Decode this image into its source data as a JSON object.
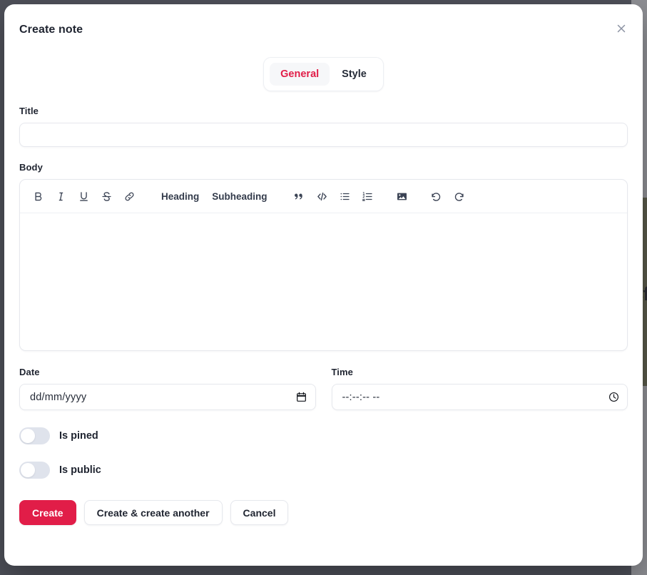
{
  "modal": {
    "title": "Create note",
    "close_label": "Close",
    "close_icon": "close-icon"
  },
  "tabs": [
    {
      "label": "General",
      "active": true
    },
    {
      "label": "Style",
      "active": false
    }
  ],
  "fields": {
    "title": {
      "label": "Title",
      "value": "",
      "placeholder": ""
    },
    "body": {
      "label": "Body",
      "value": "",
      "placeholder": ""
    },
    "date": {
      "label": "Date",
      "value": "",
      "placeholder": "dd/mm/yyyy",
      "icon": "calendar-icon"
    },
    "time": {
      "label": "Time",
      "value": "",
      "placeholder": "--:--:-- --",
      "icon": "clock-icon"
    }
  },
  "editor_toolbar": [
    {
      "name": "bold-icon",
      "label": "Bold",
      "type": "icon"
    },
    {
      "name": "italic-icon",
      "label": "Italic",
      "type": "icon"
    },
    {
      "name": "underline-icon",
      "label": "Underline",
      "type": "icon"
    },
    {
      "name": "strikethrough-icon",
      "label": "Strikethrough",
      "type": "icon"
    },
    {
      "name": "link-icon",
      "label": "Link",
      "type": "icon"
    },
    {
      "name": "heading-button",
      "label": "Heading",
      "type": "text"
    },
    {
      "name": "subheading-button",
      "label": "Subheading",
      "type": "text"
    },
    {
      "name": "blockquote-icon",
      "label": "Blockquote",
      "type": "icon"
    },
    {
      "name": "code-block-icon",
      "label": "Code block",
      "type": "icon"
    },
    {
      "name": "bullet-list-icon",
      "label": "Bullet list",
      "type": "icon"
    },
    {
      "name": "ordered-list-icon",
      "label": "Ordered list",
      "type": "icon"
    },
    {
      "name": "image-icon",
      "label": "Attachment",
      "type": "icon"
    },
    {
      "name": "undo-icon",
      "label": "Undo",
      "type": "icon"
    },
    {
      "name": "redo-icon",
      "label": "Redo",
      "type": "icon"
    }
  ],
  "toggles": [
    {
      "label": "Is pined",
      "on": false
    },
    {
      "label": "Is public",
      "on": false
    }
  ],
  "footer": {
    "create_label": "Create",
    "create_another_label": "Create & create another",
    "cancel_label": "Cancel"
  },
  "colors": {
    "accent": "#e11d48",
    "text": "#1f2430",
    "border": "#e6e8ed",
    "toggle_track": "#dfe3ec",
    "backdrop": "#73777f",
    "behind_card": "#8a8a5c"
  },
  "background": {
    "card_text": "Cfa"
  }
}
